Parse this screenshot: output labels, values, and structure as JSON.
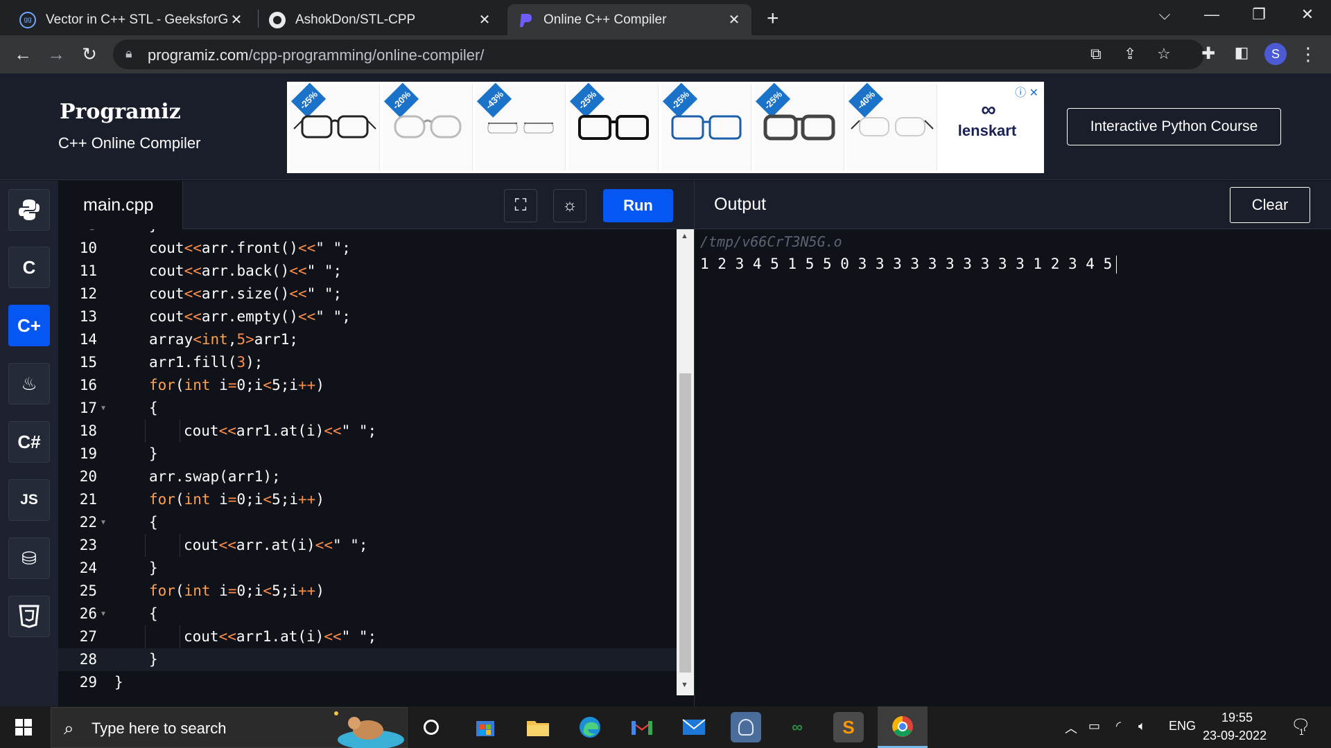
{
  "browser": {
    "tabs": [
      {
        "title": "Vector in C++ STL - GeeksforGee",
        "icon": "geeksforgeeks-icon",
        "active": false
      },
      {
        "title": "AshokDon/STL-CPP",
        "icon": "github-icon",
        "active": false
      },
      {
        "title": "Online C++ Compiler",
        "icon": "programiz-icon",
        "active": true
      }
    ],
    "close_glyph": "✕",
    "new_tab_glyph": "+",
    "url_host": "programiz.com",
    "url_path": "/cpp-programming/online-compiler/",
    "profile_initial": "S"
  },
  "site": {
    "logo_text": "Programiz",
    "subtitle": "C++ Online Compiler",
    "course_button": "Interactive Python Course"
  },
  "ad": {
    "discounts": [
      "-25%",
      "-20%",
      "-43%",
      "-25%",
      "-25%",
      "-25%",
      "-40%"
    ],
    "brand": "lenskart",
    "brand_color": "#1a2154"
  },
  "languages": [
    {
      "label": "",
      "icon": "python-icon"
    },
    {
      "label": "C",
      "icon": "c-icon"
    },
    {
      "label": "C+",
      "icon": "cpp-icon",
      "active": true
    },
    {
      "label": "",
      "icon": "java-icon"
    },
    {
      "label": "C#",
      "icon": "csharp-icon"
    },
    {
      "label": "JS",
      "icon": "javascript-icon"
    },
    {
      "label": "",
      "icon": "database-icon"
    },
    {
      "label": "",
      "icon": "html5-icon"
    }
  ],
  "editor": {
    "filename": "main.cpp",
    "run_label": "Run",
    "accent": "#0556f3",
    "lines": [
      {
        "n": "10",
        "code": "cout<<arr.front()<<\" \";",
        "indent": 1
      },
      {
        "n": "11",
        "code": "cout<<arr.back()<<\" \";",
        "indent": 1
      },
      {
        "n": "12",
        "code": "cout<<arr.size()<<\" \";",
        "indent": 1
      },
      {
        "n": "13",
        "code": "cout<<arr.empty()<<\" \";",
        "indent": 1
      },
      {
        "n": "14",
        "code": "array<int,5>arr1;",
        "indent": 1
      },
      {
        "n": "15",
        "code": "arr1.fill(3);",
        "indent": 1
      },
      {
        "n": "16",
        "code": "for(int i=0;i<5;i++)",
        "indent": 1
      },
      {
        "n": "17",
        "code": "{",
        "indent": 1,
        "fold": true
      },
      {
        "n": "18",
        "code": "cout<<arr1.at(i)<<\" \";",
        "indent": 2
      },
      {
        "n": "19",
        "code": "}",
        "indent": 1
      },
      {
        "n": "20",
        "code": "arr.swap(arr1);",
        "indent": 1
      },
      {
        "n": "21",
        "code": "for(int i=0;i<5;i++)",
        "indent": 1
      },
      {
        "n": "22",
        "code": "{",
        "indent": 1,
        "fold": true
      },
      {
        "n": "23",
        "code": "cout<<arr.at(i)<<\" \";",
        "indent": 2
      },
      {
        "n": "24",
        "code": "}",
        "indent": 1
      },
      {
        "n": "25",
        "code": "for(int i=0;i<5;i++)",
        "indent": 1
      },
      {
        "n": "26",
        "code": "{",
        "indent": 1,
        "fold": true
      },
      {
        "n": "27",
        "code": "cout<<arr1.at(i)<<\" \";",
        "indent": 2
      },
      {
        "n": "28",
        "code": "}",
        "indent": 1,
        "current": true
      },
      {
        "n": "29",
        "code": "}",
        "indent": 0
      }
    ]
  },
  "output": {
    "title": "Output",
    "clear_label": "Clear",
    "path": "/tmp/v66CrT3N5G.o",
    "result": "1 2 3 4 5 1 5 5 0 3 3 3 3 3 3 3 3 3 3 1 2 3 4 5"
  },
  "taskbar": {
    "search_placeholder": "Type here to search",
    "language": "ENG",
    "time": "19:55",
    "date": "23-09-2022",
    "notification_count": "1",
    "apps": [
      "task-view-icon",
      "microsoft-store-icon",
      "file-explorer-icon",
      "edge-icon",
      "gmail-icon",
      "mail-icon",
      "app-icon",
      "geeksforgeeks-icon",
      "sublime-text-icon",
      "chrome-icon"
    ]
  }
}
